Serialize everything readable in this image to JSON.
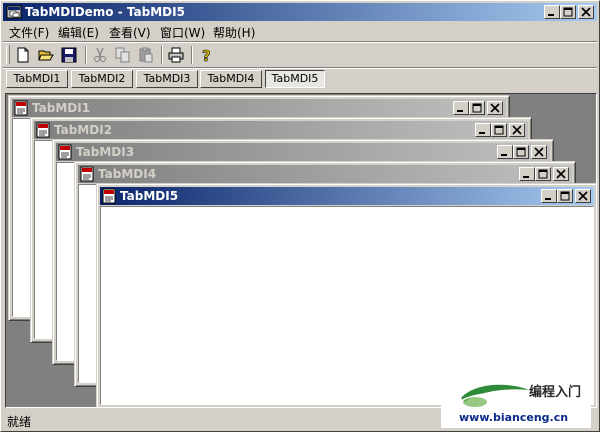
{
  "window": {
    "title": "TabMDIDemo - TabMDI5"
  },
  "menu": {
    "items": [
      "文件(F)",
      "编辑(E)",
      "查看(V)",
      "窗口(W)",
      "帮助(H)"
    ]
  },
  "toolbar": {
    "buttons": [
      "new-icon",
      "open-icon",
      "save-icon",
      "cut-icon",
      "copy-icon",
      "paste-icon",
      "print-icon",
      "help-icon"
    ]
  },
  "tabs": {
    "items": [
      "TabMDI1",
      "TabMDI2",
      "TabMDI3",
      "TabMDI4",
      "TabMDI5"
    ],
    "active": "TabMDI5"
  },
  "children": {
    "titles": [
      "TabMDI1",
      "TabMDI2",
      "TabMDI3",
      "TabMDI4",
      "TabMDI5"
    ],
    "active": "TabMDI5"
  },
  "status": {
    "text": "就绪"
  },
  "watermark": {
    "name": "编程入门",
    "url": "www.bianceng.cn"
  },
  "colors": {
    "active_title": "#0a246a",
    "inactive_title": "#808080",
    "face": "#d4d0c8",
    "workspace": "#808080"
  }
}
